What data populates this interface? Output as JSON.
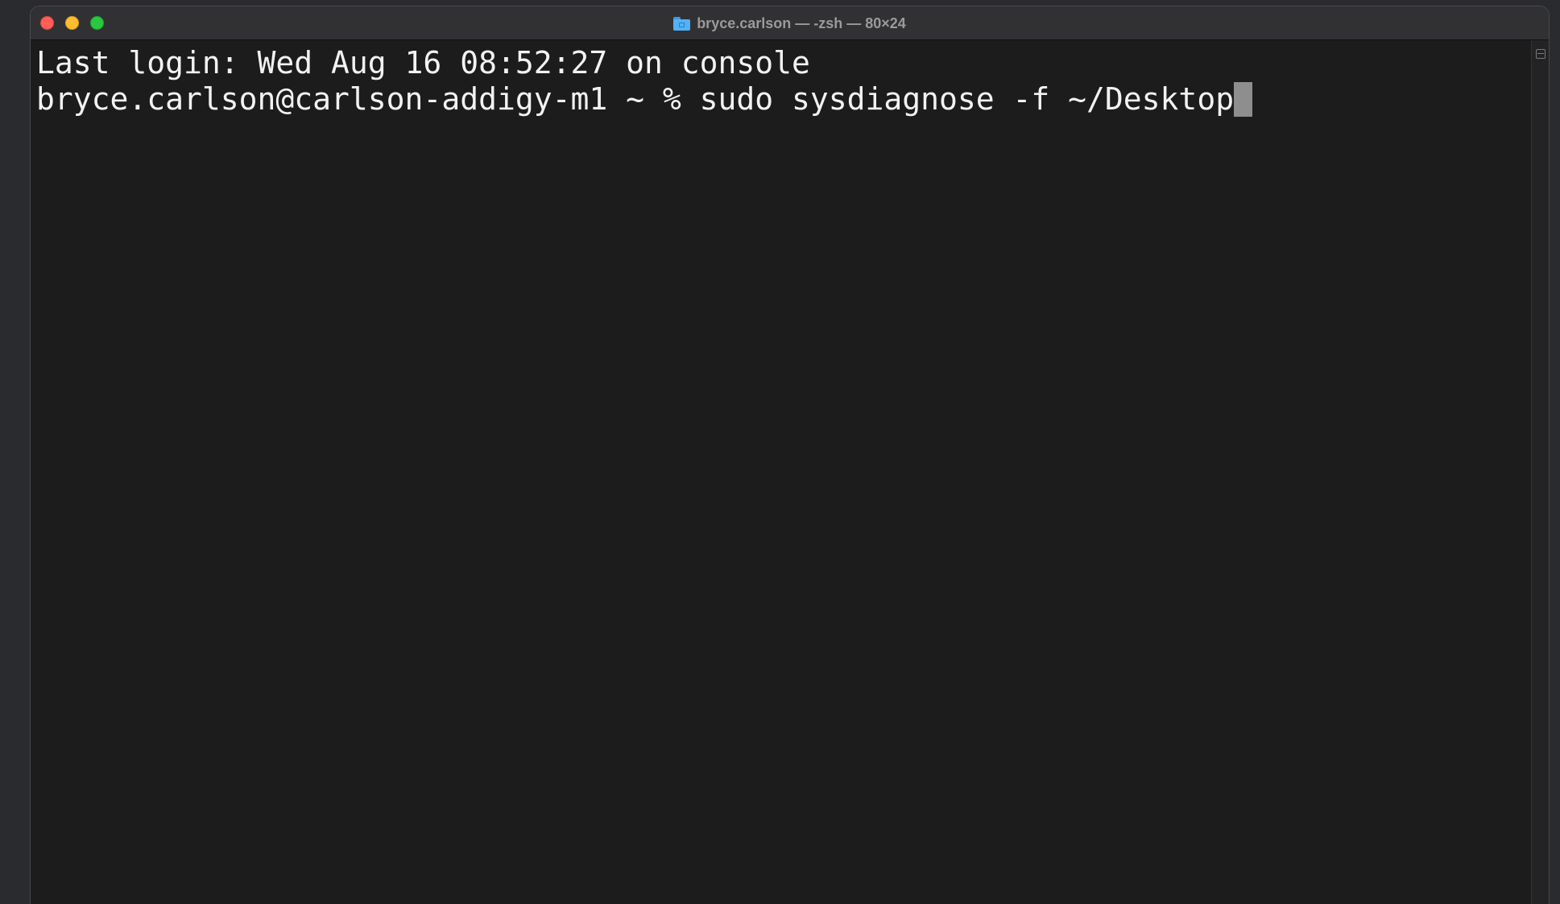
{
  "window": {
    "title": "bryce.carlson — -zsh — 80×24",
    "title_icon": "folder-icon",
    "buttons": {
      "close": "close-button",
      "minimize": "minimize-button",
      "zoom": "zoom-button"
    }
  },
  "terminal": {
    "lines": [
      {
        "text": "Last login: Wed Aug 16 08:52:27 on console"
      },
      {
        "prompt": "bryce.carlson@carlson-addigy-m1 ~ % ",
        "command": "sudo sysdiagnose -f ~/Desktop"
      }
    ],
    "colors": {
      "background": "#1c1c1c",
      "foreground": "#f2f2f2",
      "cursor": "#8e8e8e"
    }
  },
  "colors": {
    "close": "#fe5f57",
    "minimize": "#febc2e",
    "zoom": "#28c840",
    "folder": "#52b2f5"
  }
}
